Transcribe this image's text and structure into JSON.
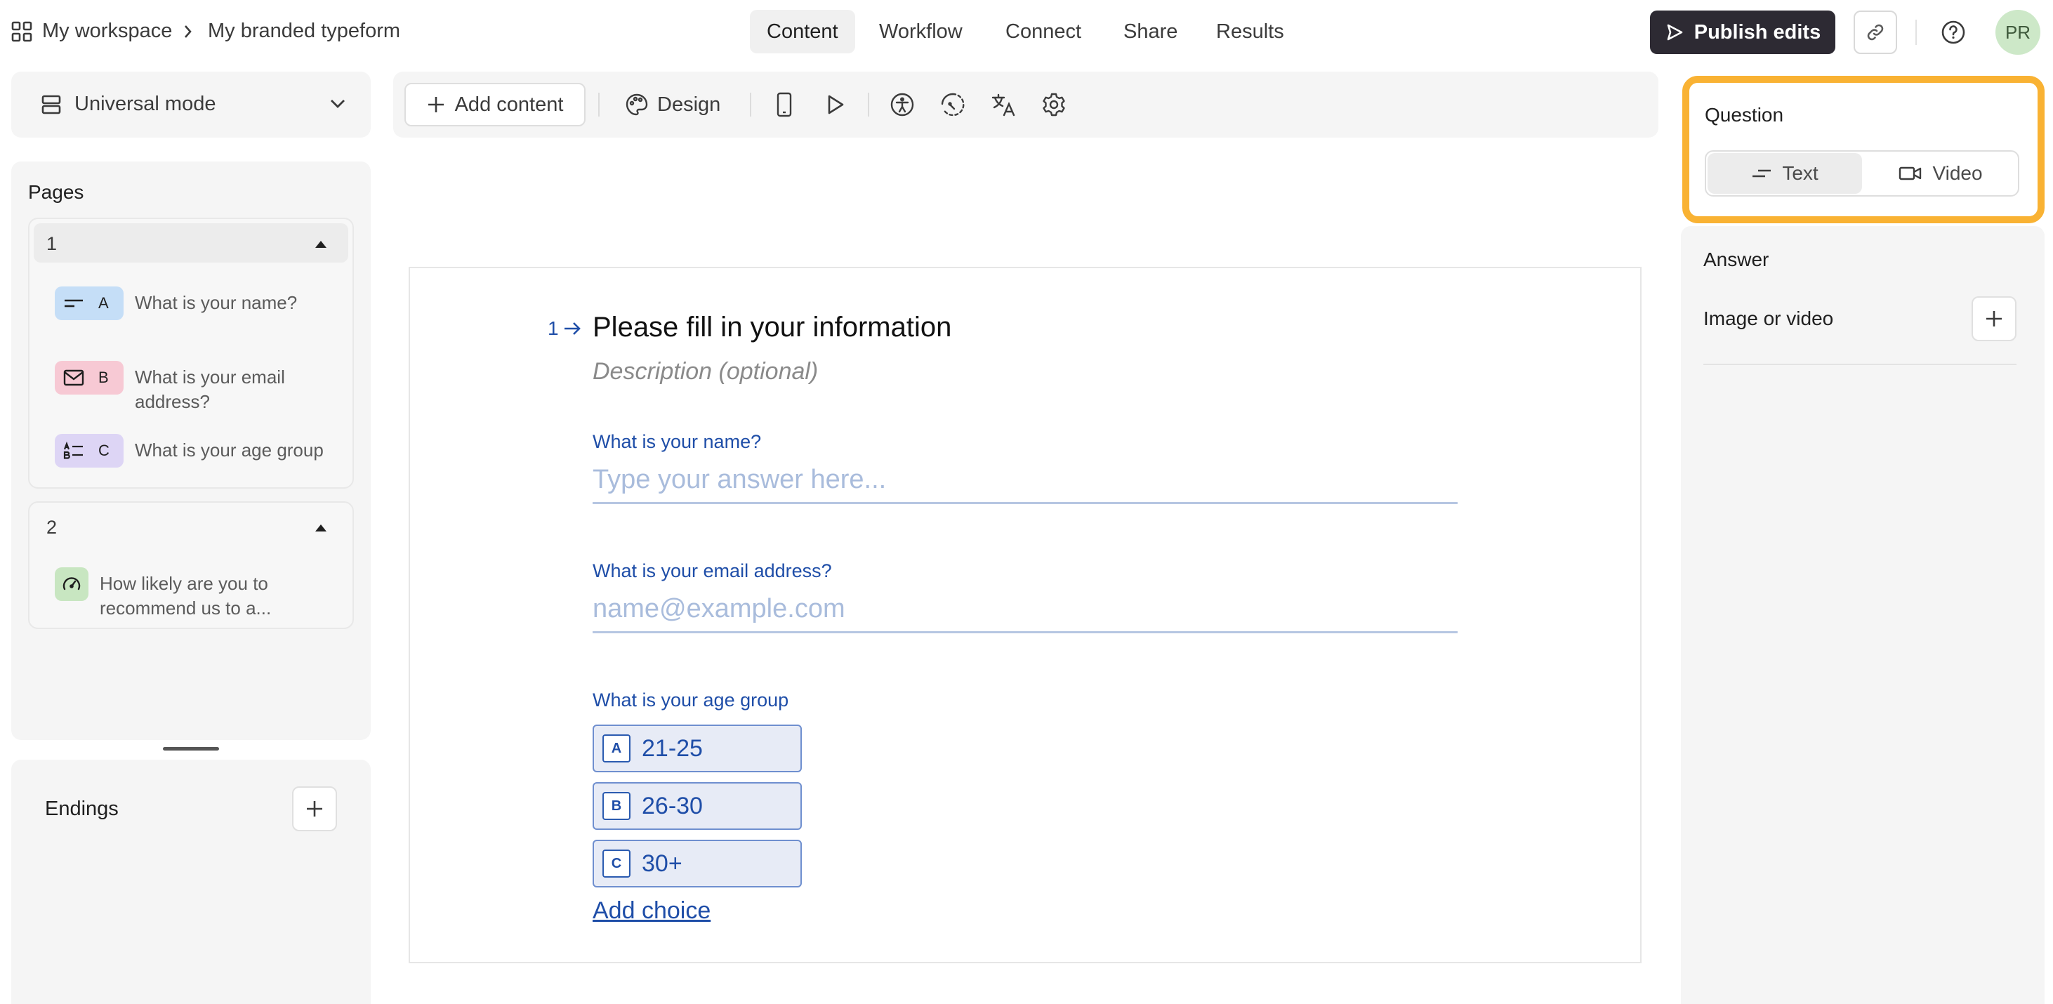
{
  "breadcrumb": {
    "workspace": "My workspace",
    "separator": "›",
    "form_name": "My branded typeform"
  },
  "nav": {
    "tabs": [
      {
        "label": "Content",
        "active": true
      },
      {
        "label": "Workflow",
        "active": false
      },
      {
        "label": "Connect",
        "active": false
      },
      {
        "label": "Share",
        "active": false
      },
      {
        "label": "Results",
        "active": false
      }
    ]
  },
  "header_actions": {
    "publish_label": "Publish edits",
    "avatar_initials": "PR"
  },
  "sidebar": {
    "mode_label": "Universal mode",
    "pages_title": "Pages",
    "pages": [
      {
        "number": "1",
        "questions": [
          {
            "letter": "A",
            "label": "What is your name?",
            "icon": "short-text-icon"
          },
          {
            "letter": "B",
            "label": "What is your email address?",
            "icon": "mail-icon"
          },
          {
            "letter": "C",
            "label": "What is your age group",
            "icon": "multiple-choice-icon"
          }
        ]
      },
      {
        "number": "2",
        "questions": [
          {
            "letter": "",
            "label": "How likely are you to recommend us to a...",
            "icon": "gauge-icon"
          }
        ]
      }
    ],
    "endings_title": "Endings"
  },
  "toolbar": {
    "add_content_label": "Add content",
    "design_label": "Design",
    "icons": [
      "mobile-preview-icon",
      "play-icon",
      "accessibility-icon",
      "logic-icon",
      "translate-icon",
      "settings-icon"
    ]
  },
  "form": {
    "question_number": "1",
    "title": "Please fill in your information",
    "description_placeholder": "Description (optional)",
    "fields": {
      "name_label": "What is your name?",
      "name_placeholder": "Type your answer here...",
      "email_label": "What is your email address?",
      "email_placeholder": "name@example.com",
      "age_label": "What is your age group"
    },
    "choices": [
      {
        "key": "A",
        "label": "21-25"
      },
      {
        "key": "B",
        "label": "26-30"
      },
      {
        "key": "C",
        "label": "30+"
      }
    ],
    "add_choice_label": "Add choice"
  },
  "settings_panel": {
    "question_label": "Question",
    "type_text": "Text",
    "type_video": "Video",
    "answer_label": "Answer",
    "media_label": "Image or video"
  },
  "colors": {
    "accent_blue": "#1f4ea8",
    "highlight_orange": "#f9b233",
    "publish_bg": "#2d2a33",
    "avatar_bg": "#cde8c8"
  }
}
